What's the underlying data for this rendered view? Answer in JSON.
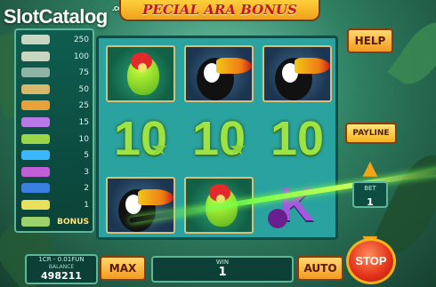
{
  "logo": {
    "brand": "SlotCatalog",
    "suffix": ".com"
  },
  "title": "PECIAL ARA BONUS",
  "paytable": [
    {
      "symbol": "parrot-symbol",
      "value": "250",
      "color": "#c9d6c1"
    },
    {
      "symbol": "toucan-symbol",
      "value": "100",
      "color": "#c9d6c1"
    },
    {
      "symbol": "butterfly-symbol",
      "value": "75",
      "color": "#8fb4a6"
    },
    {
      "symbol": "flower-symbol",
      "value": "50",
      "color": "#d8b86a"
    },
    {
      "symbol": "ace-symbol",
      "value": "25",
      "color": "#e8a23b"
    },
    {
      "symbol": "king-symbol",
      "value": "15",
      "color": "#b77ae6"
    },
    {
      "symbol": "queen-symbol",
      "value": "10",
      "color": "#9ad447"
    },
    {
      "symbol": "jack-symbol",
      "value": "5",
      "color": "#3bb7ff"
    },
    {
      "symbol": "ten-symbol",
      "value": "3",
      "color": "#c25fd6"
    },
    {
      "symbol": "nine-symbol",
      "value": "2",
      "color": "#3b7fe0"
    },
    {
      "symbol": "hundred-symbol",
      "value": "1",
      "color": "#e8e05a"
    },
    {
      "symbol": "bonus-symbol",
      "value": "BONUS",
      "color": "#9cd16b"
    }
  ],
  "reels": [
    [
      "parrot",
      "toucan",
      "toucan"
    ],
    [
      "ten",
      "ten",
      "ten"
    ],
    [
      "toucan",
      "parrot",
      "king"
    ]
  ],
  "controls": {
    "help": "HELP",
    "payline": "PAYLINE",
    "bet_label": "BET",
    "bet_value": "1",
    "max": "MAX",
    "auto": "AUTO",
    "stop": "STOP"
  },
  "balance": {
    "rate": "1CR - 0.01FUN",
    "label": "BALANCE",
    "value": "498211"
  },
  "win": {
    "label": "WIN",
    "value": "1"
  }
}
